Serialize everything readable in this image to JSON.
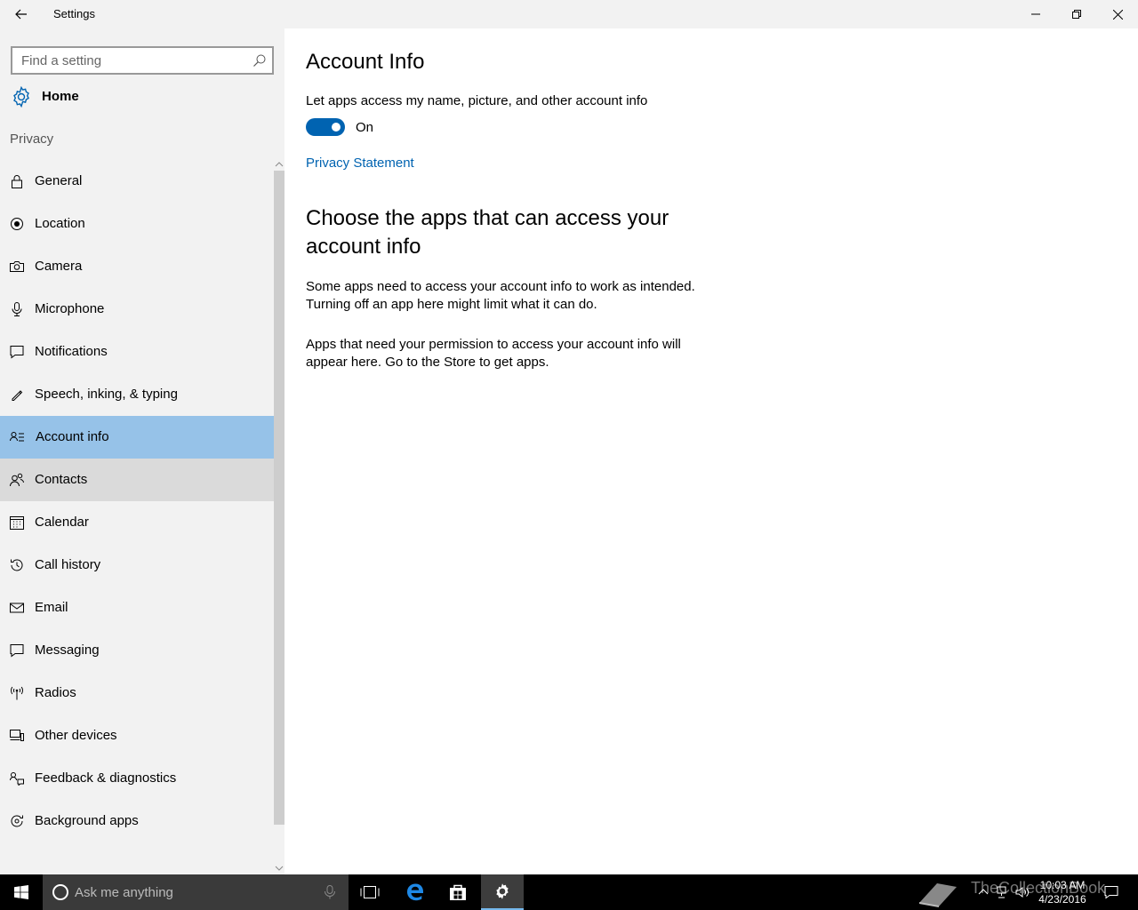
{
  "window": {
    "title": "Settings"
  },
  "sidebar": {
    "search_placeholder": "Find a setting",
    "home_label": "Home",
    "section_label": "Privacy",
    "items": [
      {
        "label": "General",
        "icon": "lock-icon"
      },
      {
        "label": "Location",
        "icon": "location-icon"
      },
      {
        "label": "Camera",
        "icon": "camera-icon"
      },
      {
        "label": "Microphone",
        "icon": "microphone-icon"
      },
      {
        "label": "Notifications",
        "icon": "notifications-icon"
      },
      {
        "label": "Speech, inking, & typing",
        "icon": "speech-icon"
      },
      {
        "label": "Account info",
        "icon": "account-info-icon",
        "selected": true
      },
      {
        "label": "Contacts",
        "icon": "contacts-icon",
        "hover": true
      },
      {
        "label": "Calendar",
        "icon": "calendar-icon"
      },
      {
        "label": "Call history",
        "icon": "history-icon"
      },
      {
        "label": "Email",
        "icon": "email-icon"
      },
      {
        "label": "Messaging",
        "icon": "messaging-icon"
      },
      {
        "label": "Radios",
        "icon": "radios-icon"
      },
      {
        "label": "Other devices",
        "icon": "devices-icon"
      },
      {
        "label": "Feedback & diagnostics",
        "icon": "feedback-icon"
      },
      {
        "label": "Background apps",
        "icon": "background-apps-icon"
      }
    ]
  },
  "main": {
    "title": "Account Info",
    "toggle_label": "Let apps access my name, picture, and other account info",
    "toggle_state": "On",
    "toggle_on": true,
    "privacy_link": "Privacy Statement",
    "section_title": "Choose the apps that can access your account info",
    "paragraph1": "Some apps need to access your account info to work as intended. Turning off an app here might limit what it can do.",
    "paragraph2": "Apps that need your permission to access your account info will appear here. Go to the Store to get apps."
  },
  "taskbar": {
    "search_placeholder": "Ask me anything",
    "time": "10:03 AM",
    "date": "4/23/2016",
    "watermark": "TheCollectionBook"
  },
  "colors": {
    "accent": "#0063b1",
    "selected_bg": "#96c2e8",
    "sidebar_bg": "#f2f2f2"
  }
}
